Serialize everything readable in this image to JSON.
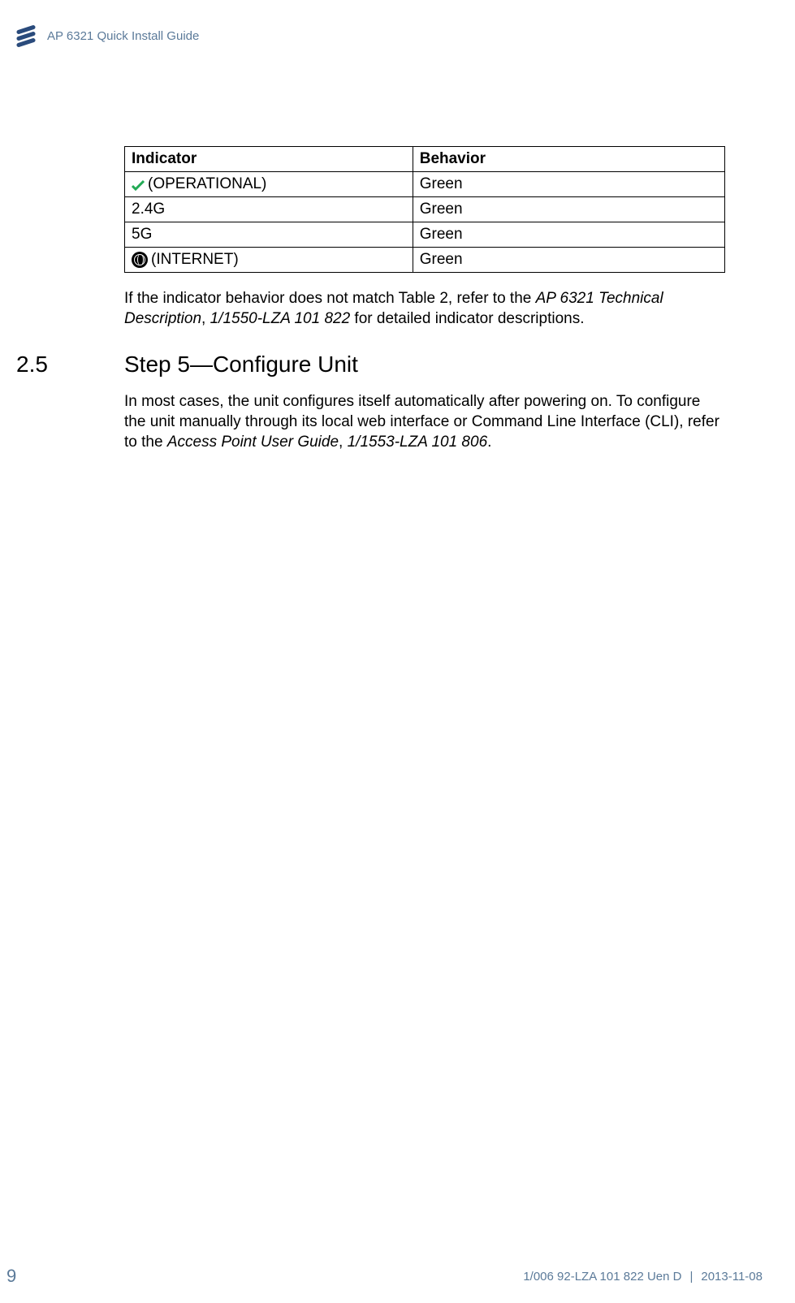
{
  "header": {
    "title": "AP 6321 Quick Install Guide"
  },
  "table": {
    "headers": {
      "indicator": "Indicator",
      "behavior": "Behavior"
    },
    "rows": [
      {
        "indicator": "(OPERATIONAL)",
        "behavior": "Green",
        "icon": "checkmark"
      },
      {
        "indicator": "2.4G",
        "behavior": "Green",
        "icon": null
      },
      {
        "indicator": "5G",
        "behavior": "Green",
        "icon": null
      },
      {
        "indicator": " (INTERNET)",
        "behavior": "Green",
        "icon": "globe"
      }
    ]
  },
  "paragraphs": {
    "p1_before": "If the indicator behavior does not match Table 2, refer to the ",
    "p1_italic1": "AP 6321 Technical Description",
    "p1_mid": ", ",
    "p1_italic2": "1/1550-LZA 101 822",
    "p1_after": " for detailed indicator descriptions.",
    "p2_before": "In most cases, the unit configures itself automatically after powering on. To configure the unit manually through its local web interface or Command Line Interface (CLI), refer to the ",
    "p2_italic1": "Access Point User Guide",
    "p2_mid": ", ",
    "p2_italic2": "1/1553-LZA 101 806",
    "p2_after": "."
  },
  "section": {
    "number": "2.5",
    "title": "Step 5—Configure Unit"
  },
  "footer": {
    "page": "9",
    "docid": "1/006 92-LZA 101 822 Uen D",
    "sep": "|",
    "date": "2013-11-08"
  }
}
